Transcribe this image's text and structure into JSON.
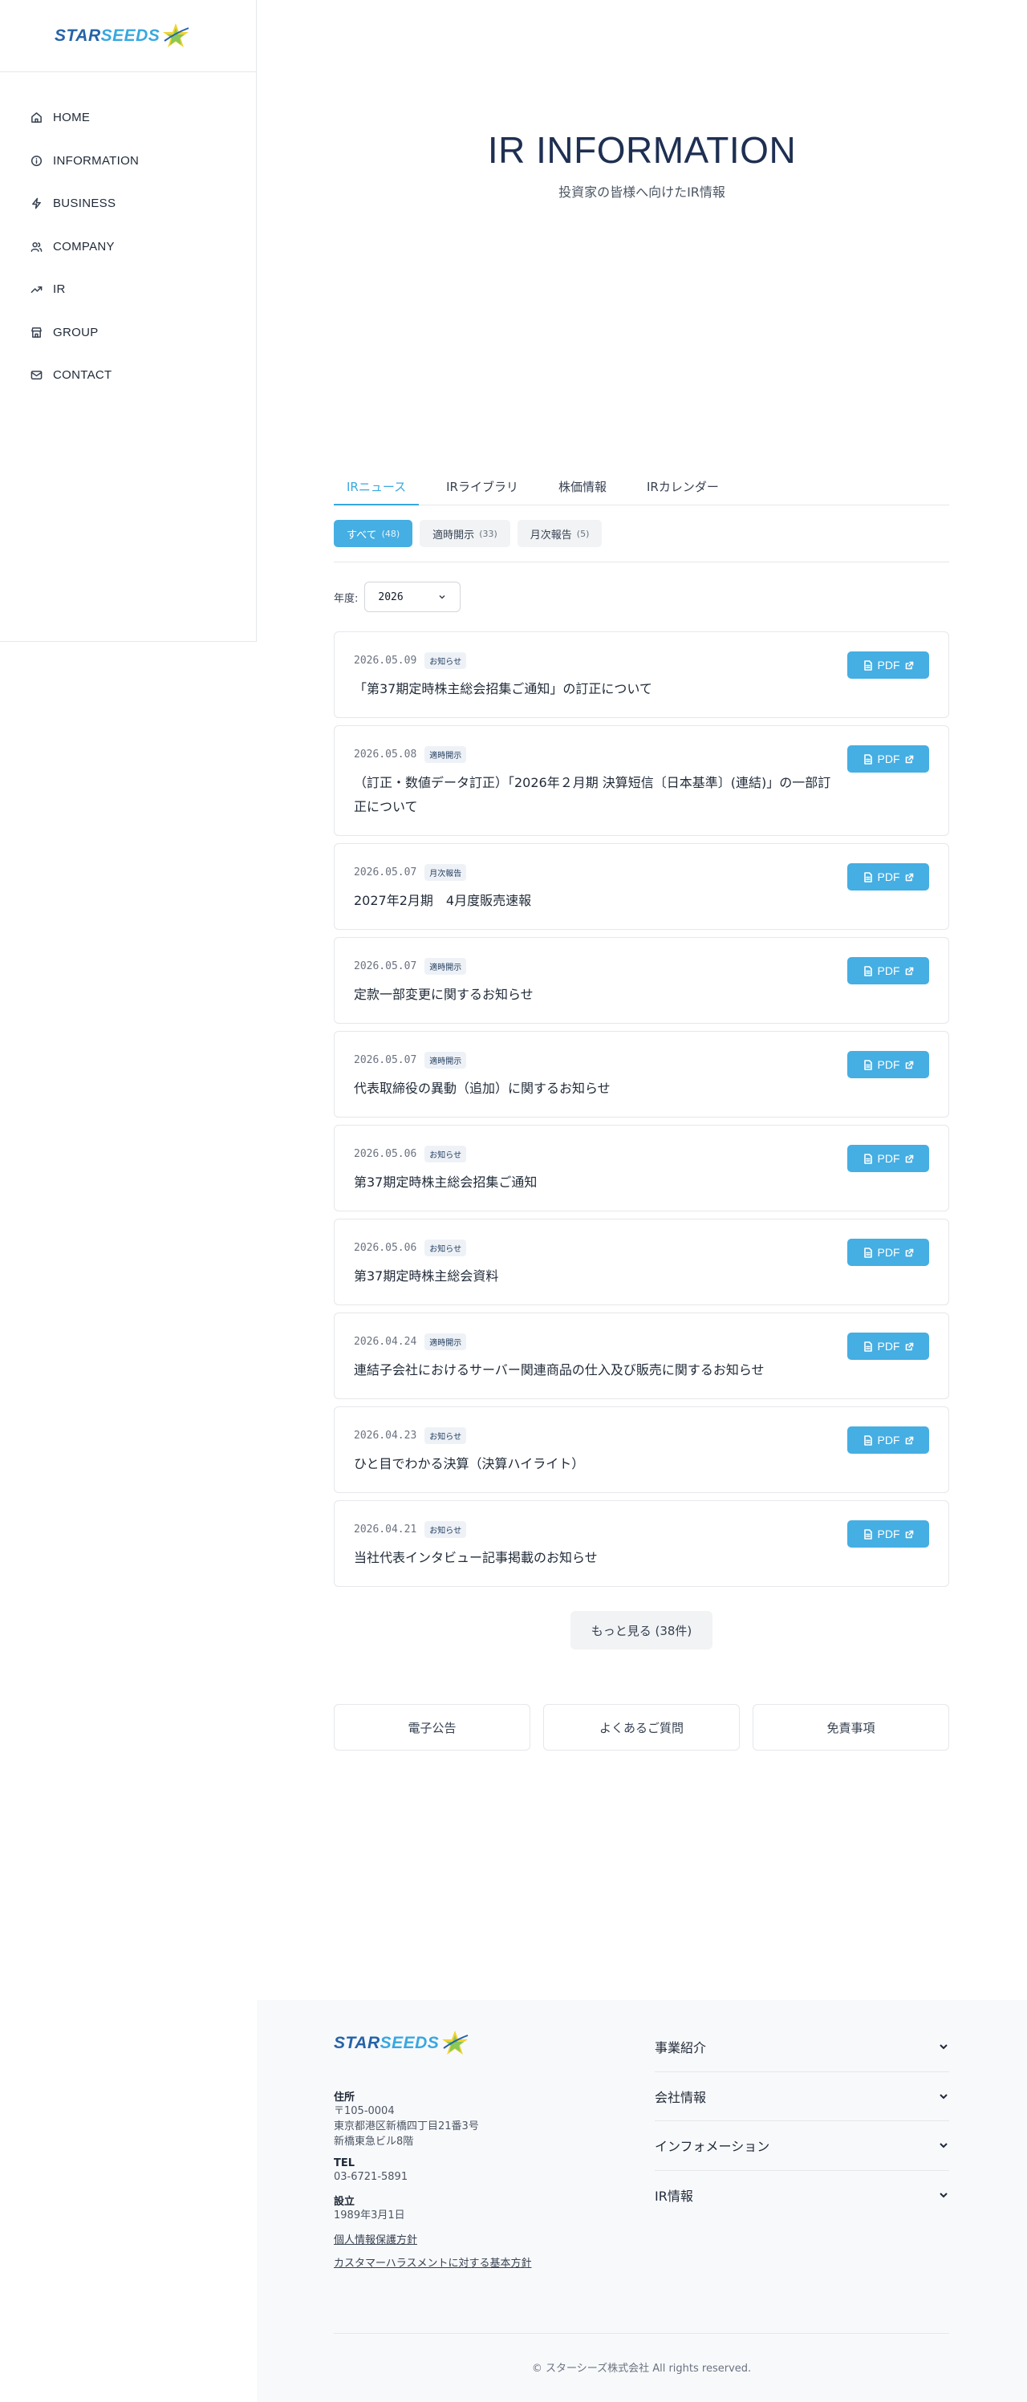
{
  "brand": {
    "logo_text_a": "STAR",
    "logo_text_b": "SEEDS"
  },
  "nav": {
    "items": [
      {
        "label": "HOME",
        "icon": "home-icon"
      },
      {
        "label": "INFORMATION",
        "icon": "info-icon"
      },
      {
        "label": "BUSINESS",
        "icon": "bolt-icon"
      },
      {
        "label": "COMPANY",
        "icon": "users-icon"
      },
      {
        "label": "IR",
        "icon": "trending-up-icon"
      },
      {
        "label": "GROUP",
        "icon": "store-icon"
      },
      {
        "label": "CONTACT",
        "icon": "mail-icon"
      }
    ]
  },
  "hero": {
    "title": "IR INFORMATION",
    "subtitle": "投資家の皆様へ向けたIR情報"
  },
  "tabs": [
    "IRニュース",
    "IRライブラリ",
    "株価情報",
    "IRカレンダー"
  ],
  "filters": [
    {
      "label": "すべて",
      "count": "(48)"
    },
    {
      "label": "適時開示",
      "count": "(33)"
    },
    {
      "label": "月次報告",
      "count": "(5)"
    }
  ],
  "year": {
    "label": "年度:",
    "value": "2026"
  },
  "news": [
    {
      "date": "2026.05.09",
      "badge": "お知らせ",
      "title": "「第37期定時株主総会招集ご通知」の訂正について",
      "pdf": "PDF"
    },
    {
      "date": "2026.05.08",
      "badge": "適時開示",
      "title": "（訂正・数値データ訂正）「2026年２月期 決算短信〔日本基準〕(連結)」の一部訂正について",
      "pdf": "PDF"
    },
    {
      "date": "2026.05.07",
      "badge": "月次報告",
      "title": "2027年2月期　4月度販売速報",
      "pdf": "PDF"
    },
    {
      "date": "2026.05.07",
      "badge": "適時開示",
      "title": "定款一部変更に関するお知らせ",
      "pdf": "PDF"
    },
    {
      "date": "2026.05.07",
      "badge": "適時開示",
      "title": "代表取締役の異動（追加）に関するお知らせ",
      "pdf": "PDF"
    },
    {
      "date": "2026.05.06",
      "badge": "お知らせ",
      "title": "第37期定時株主総会招集ご通知",
      "pdf": "PDF"
    },
    {
      "date": "2026.05.06",
      "badge": "お知らせ",
      "title": "第37期定時株主総会資料",
      "pdf": "PDF"
    },
    {
      "date": "2026.04.24",
      "badge": "適時開示",
      "title": "連結子会社におけるサーバー関連商品の仕入及び販売に関するお知らせ",
      "pdf": "PDF"
    },
    {
      "date": "2026.04.23",
      "badge": "お知らせ",
      "title": "ひと目でわかる決算（決算ハイライト）",
      "pdf": "PDF"
    },
    {
      "date": "2026.04.21",
      "badge": "お知らせ",
      "title": "当社代表インタビュー記事掲載のお知らせ",
      "pdf": "PDF"
    }
  ],
  "more_button": "もっと見る (38件)",
  "links": [
    "電子公告",
    "よくあるご質問",
    "免責事項"
  ],
  "footer": {
    "address_label": "住所",
    "address_lines": [
      "〒105-0004",
      "東京都港区新橋四丁目21番3号",
      "新橋東急ビル8階"
    ],
    "tel_label": "TEL",
    "tel": "03-6721-5891",
    "founded_label": "設立",
    "founded": "1989年3月1日",
    "privacy_link": "個人情報保護方針",
    "harassment_link": "カスタマーハラスメントに対する基本方針",
    "menu": [
      "事業紹介",
      "会社情報",
      "インフォメーション",
      "IR情報"
    ],
    "copyright": "© スターシーズ株式会社 All rights reserved."
  }
}
